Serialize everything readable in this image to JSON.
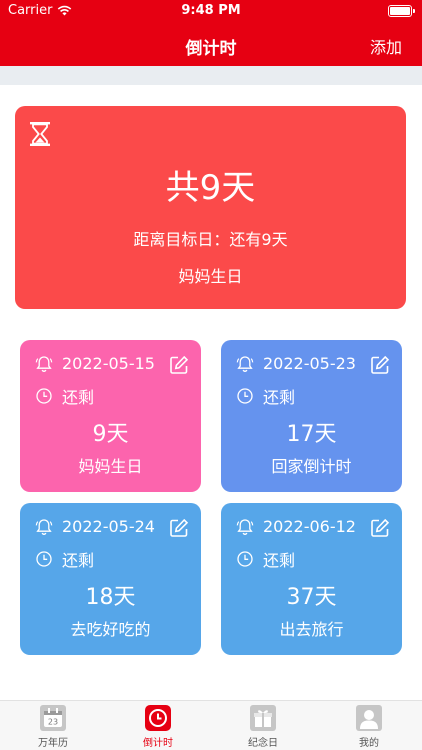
{
  "status": {
    "carrier": "Carrier",
    "time": "9:48 PM"
  },
  "nav": {
    "title": "倒计时",
    "add_label": "添加"
  },
  "hero": {
    "total": "共9天",
    "target_text": "距离目标日：还有9天",
    "name": "妈妈生日",
    "color": "#fb4a4a"
  },
  "cards": [
    {
      "date": "2022-05-15",
      "remain_label": "还剩",
      "days": "9天",
      "name": "妈妈生日",
      "color": "#fc64ad"
    },
    {
      "date": "2022-05-23",
      "remain_label": "还剩",
      "days": "17天",
      "name": "回家倒计时",
      "color": "#6593ee"
    },
    {
      "date": "2022-05-24",
      "remain_label": "还剩",
      "days": "18天",
      "name": "去吃好吃的",
      "color": "#56a6e9"
    },
    {
      "date": "2022-06-12",
      "remain_label": "还剩",
      "days": "37天",
      "name": "出去旅行",
      "color": "#56a6e9"
    }
  ],
  "tabs": [
    {
      "label": "万年历",
      "icon": "calendar-icon",
      "day_number": "23"
    },
    {
      "label": "倒计时",
      "icon": "clock-icon",
      "active": true
    },
    {
      "label": "纪念日",
      "icon": "gift-icon"
    },
    {
      "label": "我的",
      "icon": "person-icon"
    }
  ],
  "colors": {
    "accent": "#e60012",
    "background_strip": "#e9edf1"
  }
}
